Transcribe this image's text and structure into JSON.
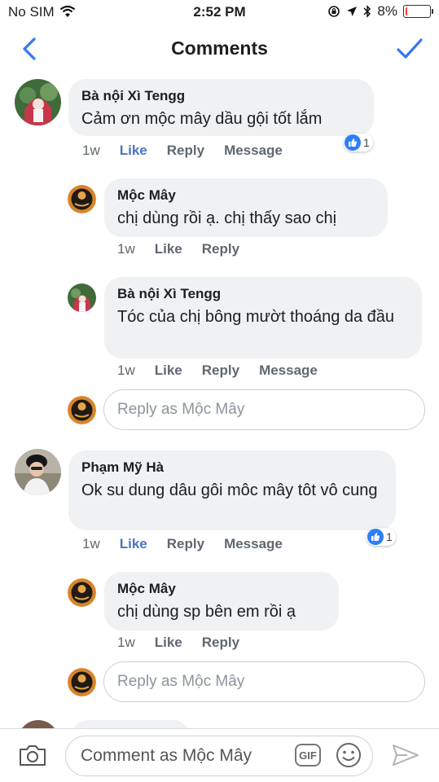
{
  "status_bar": {
    "carrier": "No SIM",
    "time": "2:52 PM",
    "battery": "8%",
    "battery_level": 0.08
  },
  "nav": {
    "title": "Comments",
    "back_icon": "chevron-left-icon",
    "done_icon": "checkmark-icon"
  },
  "colors": {
    "accent": "#3478f6",
    "like_blue": "#4a75c0",
    "bubble": "#f0f1f3",
    "battery_low": "#ff3b30"
  },
  "comments": [
    {
      "author": "Bà nội Xì Tengg",
      "text": "Cảm ơn mộc mây dầu gội tốt lắm",
      "time": "1w",
      "like": "Like",
      "reply": "Reply",
      "message": "Message",
      "reaction_count": "1",
      "replies": [
        {
          "author": "Mộc Mây",
          "text": "chị dùng rồi ạ. chị thấy sao chị",
          "time": "1w",
          "like": "Like",
          "reply": "Reply"
        },
        {
          "author": "Bà nội Xì Tengg",
          "text": "Tóc của chị bông  mườt thoáng da đầu",
          "time": "1w",
          "like": "Like",
          "reply": "Reply",
          "message": "Message"
        }
      ],
      "reply_placeholder": "Reply as Mộc Mây"
    },
    {
      "author": "Phạm Mỹ Hà",
      "text": "Ok su dung dâu gôi môc mây tôt vô cung",
      "time": "1w",
      "like": "Like",
      "reply": "Reply",
      "message": "Message",
      "reaction_count": "1",
      "replies": [
        {
          "author": "Mộc Mây",
          "text": "chị dùng sp bên em rồi ạ",
          "time": "1w",
          "like": "Like",
          "reply": "Reply"
        }
      ],
      "reply_placeholder": "Reply as Mộc Mây"
    }
  ],
  "composer": {
    "placeholder": "Comment as Mộc Mây",
    "gif_label": "GIF"
  }
}
